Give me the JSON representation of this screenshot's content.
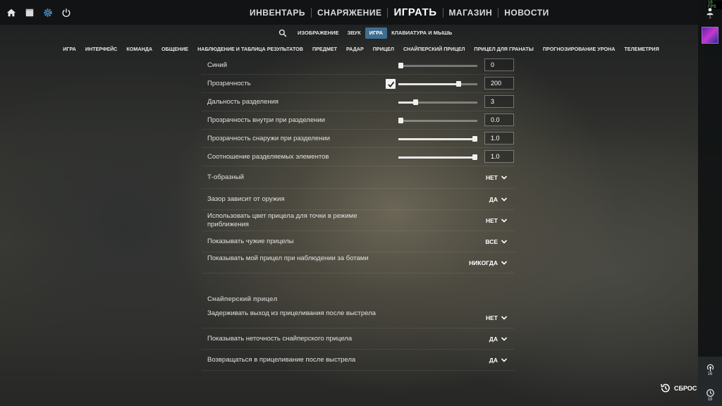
{
  "fps": "16 FPS",
  "top_icons": [
    "home-icon",
    "inventory-box-icon",
    "gear-icon",
    "power-icon"
  ],
  "main_nav": {
    "items": [
      {
        "label": "ИНВЕНТАРЬ"
      },
      {
        "label": "СНАРЯЖЕНИЕ"
      },
      {
        "label": "ИГРАТЬ"
      },
      {
        "label": "МАГАЗИН"
      },
      {
        "label": "НОВОСТИ"
      }
    ]
  },
  "subnav": {
    "items": [
      {
        "label": "ИЗОБРАЖЕНИЕ",
        "active": false
      },
      {
        "label": "ЗВУК",
        "active": false
      },
      {
        "label": "ИГРА",
        "active": true
      },
      {
        "label": "КЛАВИАТУРА И МЫШЬ",
        "active": false
      }
    ]
  },
  "categories": [
    "ИГРА",
    "ИНТЕРФЕЙС",
    "КОМАНДА",
    "ОБЩЕНИЕ",
    "НАБЛЮДЕНИЕ И ТАБЛИЦА РЕЗУЛЬТАТОВ",
    "ПРЕДМЕТ",
    "РАДАР",
    "ПРИЦЕЛ",
    "СНАЙПЕРСКИЙ ПРИЦЕЛ",
    "ПРИЦЕЛ ДЛЯ ГРАНАТЫ",
    "ПРОГНОЗИРОВАНИЕ УРОНА",
    "ТЕЛЕМЕТРИЯ"
  ],
  "settings": {
    "blue": {
      "label": "Синий",
      "value": "0",
      "fraction": 0.0
    },
    "opacity": {
      "label": "Прозрачность",
      "value": "200",
      "fraction": 0.78,
      "checked": true
    },
    "split_distance": {
      "label": "Дальность разделения",
      "value": "3",
      "fraction": 0.2
    },
    "inner_split_alpha": {
      "label": "Прозрачность внутри при разделении",
      "value": "0.0",
      "fraction": 0.0
    },
    "outer_split_alpha": {
      "label": "Прозрачность снаружи при разделении",
      "value": "1.0",
      "fraction": 1.0
    },
    "split_size_ratio": {
      "label": "Соотношение разделяемых элементов",
      "value": "1.0",
      "fraction": 1.0
    },
    "t_style": {
      "label": "Т-образный",
      "value": "НЕТ"
    },
    "gap_weapon": {
      "label": "Зазор зависит от оружия",
      "value": "ДА"
    },
    "zoom_dot_color": {
      "label": "Использовать цвет прицела для точки в режиме приближения",
      "value": "НЕТ"
    },
    "show_others": {
      "label": "Показывать чужие прицелы",
      "value": "ВСЕ"
    },
    "show_mine_bots": {
      "label": "Показывать мой прицел при наблюдении за ботами",
      "value": "НИКОГДА"
    }
  },
  "sniper": {
    "title": "Снайперский прицел",
    "delay_unscope": {
      "label": "Задерживать выход из прицеливания после выстрела",
      "value": "НЕТ"
    },
    "show_inaccuracy": {
      "label": "Показывать неточность снайперского прицела",
      "value": "ДА"
    },
    "rezoom": {
      "label": "Возвращаться в прицеливание после выстрела",
      "value": "ДА"
    }
  },
  "sidebar": {
    "friends_count": "1",
    "broadcast_count": "16",
    "history_count": "18"
  },
  "reset_label": "СБРОС"
}
